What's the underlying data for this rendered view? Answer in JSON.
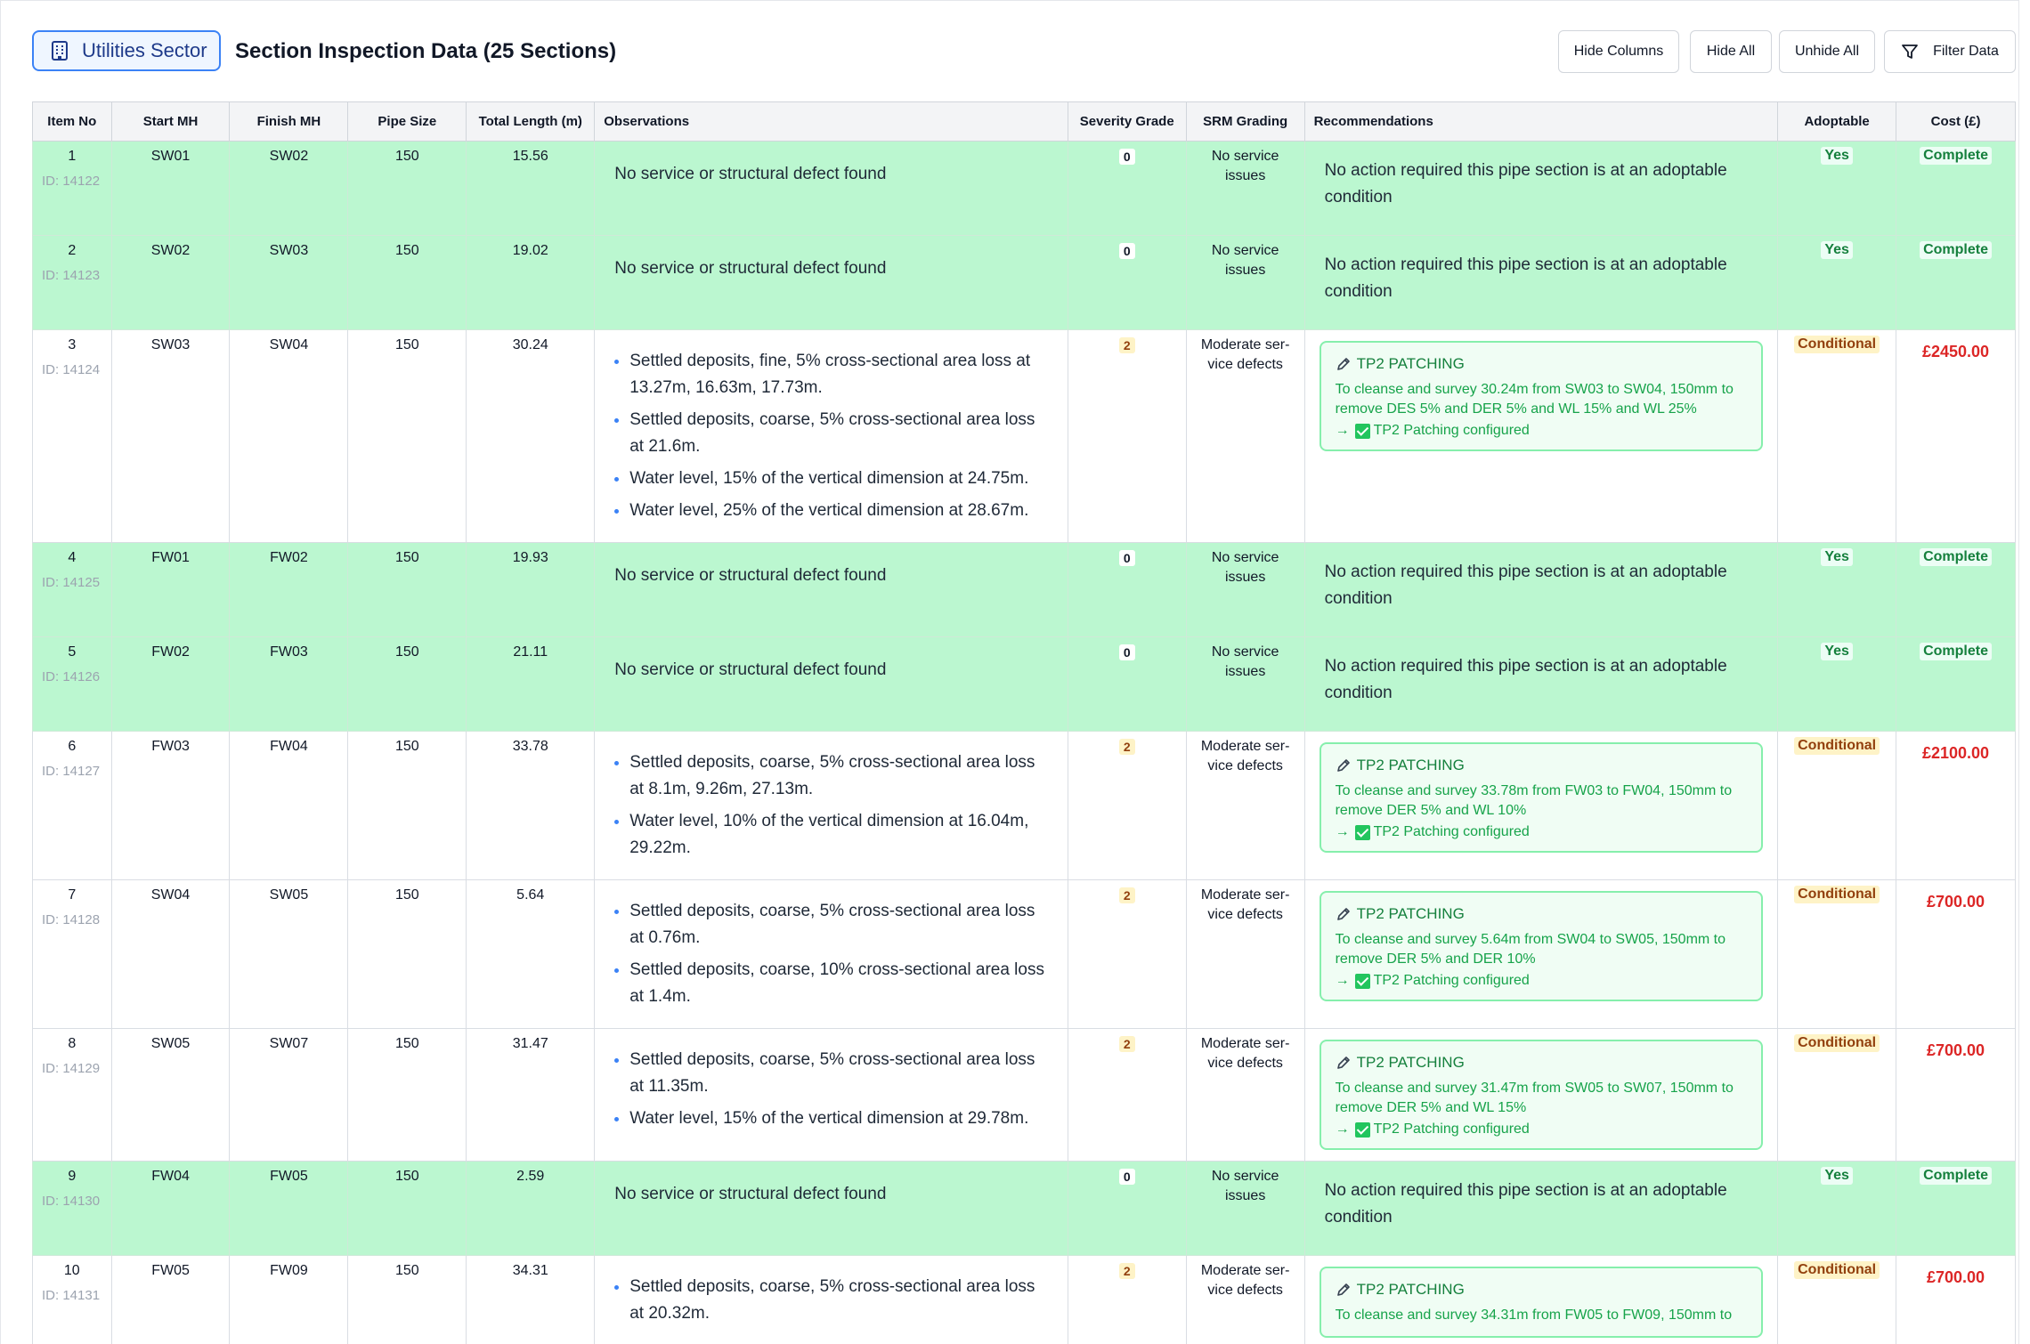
{
  "header": {
    "sector_label": "Utilities Sector",
    "title": "Section Inspection Data (25 Sections)",
    "buttons": {
      "hide_columns": "Hide Columns",
      "hide_all": "Hide All",
      "unhide_all": "Unhide All",
      "filter_data": "Filter Data"
    }
  },
  "table": {
    "columns": [
      "Item No",
      "Start MH",
      "Finish MH",
      "Pipe Size",
      "Total Length (m)",
      "Observations",
      "Severity Grade",
      "SRM Grading",
      "Recommendations",
      "Adoptable",
      "Cost (£)"
    ],
    "rows": [
      {
        "item": "1",
        "id": "ID: 14122",
        "start": "SW01",
        "finish": "SW02",
        "size": "150",
        "length": "15.56",
        "obs_plain": "No service or structural defect found",
        "severity": "0",
        "srm": "No service issues",
        "rec_plain": "No action required this pipe section is at an adoptable condition",
        "adoptable": "Yes",
        "cost": "Complete"
      },
      {
        "item": "2",
        "id": "ID: 14123",
        "start": "SW02",
        "finish": "SW03",
        "size": "150",
        "length": "19.02",
        "obs_plain": "No service or structural defect found",
        "severity": "0",
        "srm": "No service issues",
        "rec_plain": "No action required this pipe section is at an adoptable condition",
        "adoptable": "Yes",
        "cost": "Complete"
      },
      {
        "item": "3",
        "id": "ID: 14124",
        "start": "SW03",
        "finish": "SW04",
        "size": "150",
        "length": "30.24",
        "obs": [
          "Settled deposits, fine, 5% cross-sectional area loss at 13.27m, 16.63m, 17.73m.",
          "Settled deposits, coarse, 5% cross-sectional area loss at 21.6m.",
          "Water level, 15% of the vertical dimension at 24.75m.",
          "Water level, 25% of the vertical dimension at 28.67m."
        ],
        "severity": "2",
        "srm": "Moderate ser-vice defects",
        "rec_title": "TP2 PATCHING",
        "rec_desc": "To cleanse and survey 30.24m from SW03 to SW04, 150mm to remove DES 5% and DER 5% and WL 15% and WL 25%",
        "rec_config": "TP2 Patching configured",
        "adoptable": "Conditional",
        "cost": "£2450.00"
      },
      {
        "item": "4",
        "id": "ID: 14125",
        "start": "FW01",
        "finish": "FW02",
        "size": "150",
        "length": "19.93",
        "obs_plain": "No service or structural defect found",
        "severity": "0",
        "srm": "No service issues",
        "rec_plain": "No action required this pipe section is at an adoptable condition",
        "adoptable": "Yes",
        "cost": "Complete"
      },
      {
        "item": "5",
        "id": "ID: 14126",
        "start": "FW02",
        "finish": "FW03",
        "size": "150",
        "length": "21.11",
        "obs_plain": "No service or structural defect found",
        "severity": "0",
        "srm": "No service issues",
        "rec_plain": "No action required this pipe section is at an adoptable condition",
        "adoptable": "Yes",
        "cost": "Complete"
      },
      {
        "item": "6",
        "id": "ID: 14127",
        "start": "FW03",
        "finish": "FW04",
        "size": "150",
        "length": "33.78",
        "obs": [
          "Settled deposits, coarse, 5% cross-sectional area loss at 8.1m, 9.26m, 27.13m.",
          "Water level, 10% of the vertical dimension at 16.04m, 29.22m."
        ],
        "severity": "2",
        "srm": "Moderate ser-vice defects",
        "rec_title": "TP2 PATCHING",
        "rec_desc": "To cleanse and survey 33.78m from FW03 to FW04, 150mm to remove DER 5% and WL 10%",
        "rec_config": "TP2 Patching configured",
        "adoptable": "Conditional",
        "cost": "£2100.00"
      },
      {
        "item": "7",
        "id": "ID: 14128",
        "start": "SW04",
        "finish": "SW05",
        "size": "150",
        "length": "5.64",
        "obs": [
          "Settled deposits, coarse, 5% cross-sectional area loss at 0.76m.",
          "Settled deposits, coarse, 10% cross-sectional area loss at 1.4m."
        ],
        "severity": "2",
        "srm": "Moderate ser-vice defects",
        "rec_title": "TP2 PATCHING",
        "rec_desc": "To cleanse and survey 5.64m from SW04 to SW05, 150mm to remove DER 5% and DER 10%",
        "rec_config": "TP2 Patching configured",
        "adoptable": "Conditional",
        "cost": "£700.00"
      },
      {
        "item": "8",
        "id": "ID: 14129",
        "start": "SW05",
        "finish": "SW07",
        "size": "150",
        "length": "31.47",
        "obs": [
          "Settled deposits, coarse, 5% cross-sectional area loss at 11.35m.",
          "Water level, 15% of the vertical dimension at 29.78m."
        ],
        "severity": "2",
        "srm": "Moderate ser-vice defects",
        "rec_title": "TP2 PATCHING",
        "rec_desc": "To cleanse and survey 31.47m from SW05 to SW07, 150mm to remove DER 5% and WL 15%",
        "rec_config": "TP2 Patching configured",
        "adoptable": "Conditional",
        "cost": "£700.00"
      },
      {
        "item": "9",
        "id": "ID: 14130",
        "start": "FW04",
        "finish": "FW05",
        "size": "150",
        "length": "2.59",
        "obs_plain": "No service or structural defect found",
        "severity": "0",
        "srm": "No service issues",
        "rec_plain": "No action required this pipe section is at an adoptable condition",
        "adoptable": "Yes",
        "cost": "Complete"
      },
      {
        "item": "10",
        "id": "ID: 14131",
        "start": "FW05",
        "finish": "FW09",
        "size": "150",
        "length": "34.31",
        "obs": [
          "Settled deposits, coarse, 5% cross-sectional area loss at 20.32m."
        ],
        "severity": "2",
        "srm": "Moderate ser-vice defects",
        "rec_title": "TP2 PATCHING",
        "rec_desc": "To cleanse and survey 34.31m from FW05 to FW09, 150mm to",
        "rec_config": "",
        "adoptable": "Conditional",
        "cost": "£700.00"
      }
    ]
  },
  "colors": {
    "ok_row": "#bbf7d0",
    "accent_blue": "#3b82f6",
    "cost_red": "#dc2626",
    "tp2_green": "#16a34a",
    "conditional_bg": "#fef3c7"
  },
  "icons": {
    "sector": "building-icon",
    "filter": "filter-icon",
    "recommendation": "pencil-icon",
    "configured": "check-box-icon",
    "arrow": "arrow-right-icon"
  }
}
